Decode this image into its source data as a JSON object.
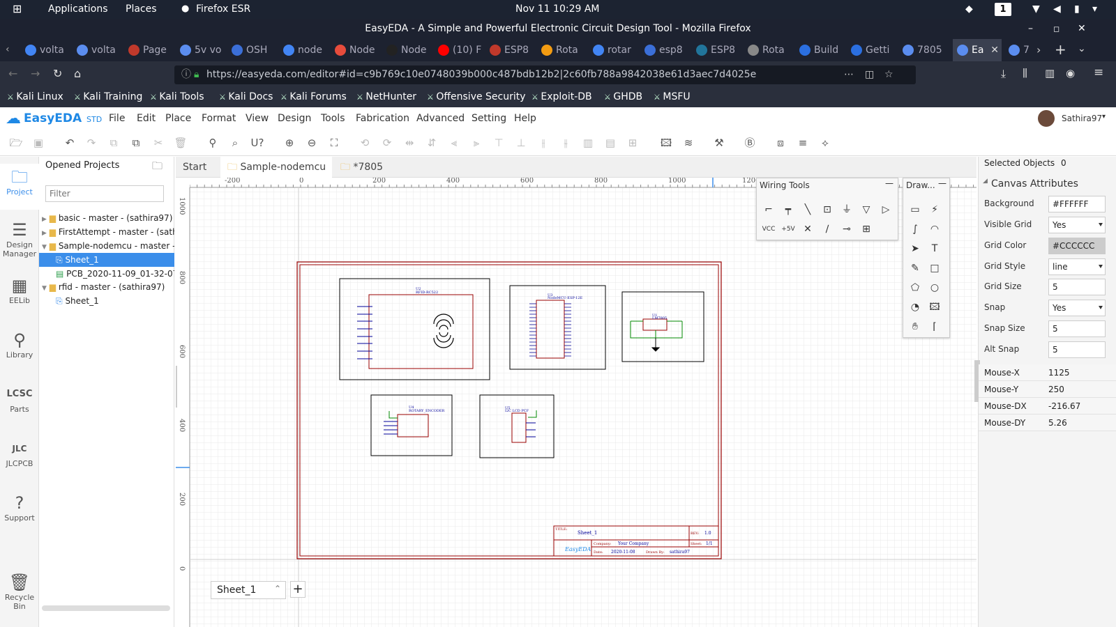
{
  "topbar": {
    "activities": "⊞",
    "applications": "Applications",
    "places": "Places",
    "firefox": "Firefox ESR",
    "datetime": "Nov 11  10:29 AM",
    "workspace": "1"
  },
  "window": {
    "title": "EasyEDA - A Simple and Powerful Electronic Circuit Design Tool - Mozilla Firefox"
  },
  "tabs": [
    {
      "label": "volta",
      "color": "#4285f4"
    },
    {
      "label": "volta",
      "color": "#5b8def"
    },
    {
      "label": "Page",
      "color": "#c0392b"
    },
    {
      "label": "5v vo",
      "color": "#5b8def"
    },
    {
      "label": "OSH",
      "color": "#3b6fd8"
    },
    {
      "label": "node",
      "color": "#4285f4"
    },
    {
      "label": "Node",
      "color": "#e74c3c"
    },
    {
      "label": "Node",
      "color": "#222"
    },
    {
      "label": "(10) F",
      "color": "#ff0000"
    },
    {
      "label": "ESP8",
      "color": "#c0392b"
    },
    {
      "label": "Rota",
      "color": "#f39c12"
    },
    {
      "label": "rotar",
      "color": "#4285f4"
    },
    {
      "label": "esp8",
      "color": "#3b6fd8"
    },
    {
      "label": "ESP8",
      "color": "#21759b"
    },
    {
      "label": "Rota",
      "color": "#888"
    },
    {
      "label": "Build",
      "color": "#2b6fe0"
    },
    {
      "label": "Getti",
      "color": "#2b6fe0"
    },
    {
      "label": "7805",
      "color": "#5b8def"
    },
    {
      "label": "Ea",
      "color": "#5b8def"
    },
    {
      "label": "7",
      "color": "#5b8def"
    }
  ],
  "nav": {
    "url": "https://easyeda.com/editor#id=c9b769c10e0748039b000c487bdb12b2|2c60fb788a9842038e61d3aec7d4025e"
  },
  "bookmarks": [
    "Kali Linux",
    "Kali Training",
    "Kali Tools",
    "Kali Docs",
    "Kali Forums",
    "NetHunter",
    "Offensive Security",
    "Exploit-DB",
    "GHDB",
    "MSFU"
  ],
  "app": {
    "brand": "EasyEDA",
    "brand_suffix": "STD",
    "menus": [
      "File",
      "Edit",
      "Place",
      "Format",
      "View",
      "Design",
      "Tools",
      "Fabrication",
      "Advanced",
      "Setting",
      "Help"
    ],
    "user": "Sathira97"
  },
  "leftnav": [
    "Project",
    "Design Manager",
    "EELib",
    "Library",
    "Parts",
    "JLCPCB",
    "Support",
    "Recycle Bin"
  ],
  "projects": {
    "header": "Opened Projects",
    "filter_placeholder": "Filter",
    "items": [
      "basic - master - (sathira97)",
      "FirstAttempt - master - (sathira",
      "Sample-nodemcu - master - (s",
      "Sheet_1",
      "PCB_2020-11-09_01-32-07",
      "rfid - master - (sathira97)",
      "Sheet_1"
    ]
  },
  "doctabs": [
    "Start",
    "Sample-nodemcu",
    "*7805"
  ],
  "ruler": {
    "top": [
      "-200",
      "0",
      "200",
      "400",
      "600",
      "800",
      "1000",
      "1200"
    ],
    "left": [
      "1000",
      "800",
      "600",
      "400",
      "200",
      "0"
    ]
  },
  "palettes": {
    "wiring": "Wiring Tools",
    "drawing": "Draw..."
  },
  "schematic": {
    "u2": "U2",
    "u2_part": "RFID-RC522",
    "u3": "U3",
    "u3_part": "NodeMCU-ESP-12E",
    "u1": "U1",
    "u1_part": "LM7805",
    "u4": "U4",
    "u4_part": "ROTARY_ENCODER",
    "u5": "U5",
    "u5_part": "I2C LCD PCF",
    "title_label": "TITLE:",
    "title_value": "Sheet_1",
    "rev_label": "REV:",
    "rev_value": "1.0",
    "company_label": "Company:",
    "company_value": "Your Company",
    "sheet_label": "Sheet:",
    "sheet_value": "1/1",
    "date_label": "Date:",
    "date_value": "2020-11-08",
    "drawn_label": "Drawn By:",
    "drawn_value": "sathira97",
    "logo": "EasyEDA"
  },
  "sheet_tab": "Sheet_1",
  "props": {
    "selected_label": "Selected Objects",
    "selected_value": "0",
    "section": "Canvas Attributes",
    "rows": [
      {
        "label": "Background",
        "value": "#FFFFFF"
      },
      {
        "label": "Visible Grid",
        "value": "Yes"
      },
      {
        "label": "Grid Color",
        "value": "#CCCCCC"
      },
      {
        "label": "Grid Style",
        "value": "line"
      },
      {
        "label": "Grid Size",
        "value": "5"
      },
      {
        "label": "Snap",
        "value": "Yes"
      },
      {
        "label": "Snap Size",
        "value": "5"
      },
      {
        "label": "Alt Snap",
        "value": "5"
      }
    ],
    "mouse": [
      {
        "label": "Mouse-X",
        "value": "1125"
      },
      {
        "label": "Mouse-Y",
        "value": "250"
      },
      {
        "label": "Mouse-DX",
        "value": "-216.67"
      },
      {
        "label": "Mouse-DY",
        "value": "5.26"
      }
    ]
  },
  "colors": {
    "accent": "#3b8eea",
    "schematic_frame": "#990000",
    "wire": "#008800",
    "pin": "#000099"
  }
}
